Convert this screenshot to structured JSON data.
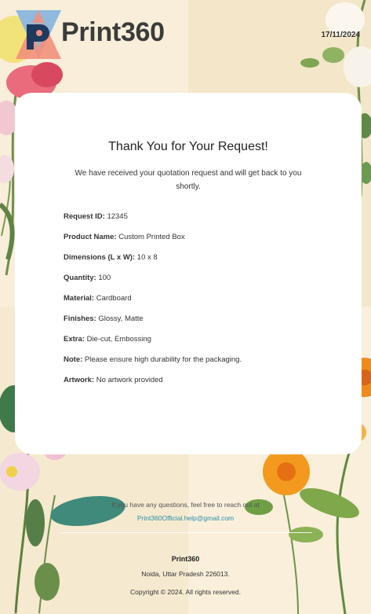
{
  "header": {
    "brand": "Print360",
    "date": "17/11/2024"
  },
  "card": {
    "title": "Thank You for Your Request!",
    "message": "We have received your quotation request and will get back to you shortly.",
    "details": [
      {
        "label": "Request ID:",
        "value": "12345"
      },
      {
        "label": "Product Name:",
        "value": "Custom Printed Box"
      },
      {
        "label": "Dimensions (L x W):",
        "value": "10 x 8"
      },
      {
        "label": "Quantity:",
        "value": "100"
      },
      {
        "label": "Material:",
        "value": "Cardboard"
      },
      {
        "label": "Finishes:",
        "value": "Glossy, Matte"
      },
      {
        "label": "Extra:",
        "value": "Die-cut, Embossing"
      },
      {
        "label": "Note:",
        "value": "Please ensure high durability for the packaging."
      },
      {
        "label": "Artwork:",
        "value": "No artwork provided"
      }
    ]
  },
  "footer": {
    "contact_text": "If you have any questions, feel free to reach out at",
    "email": "Print360Official.help@gmail.com",
    "company": "Print360",
    "address": "Noida, Uttar Pradesh 226013.",
    "copyright": "Copyright © 2024. All rights reserved."
  },
  "colors": {
    "background": "#f7edd6",
    "card": "#ffffff",
    "link": "#2a8fa8",
    "logo_blue": "#1e3a5f",
    "logo_salmon": "#f2907a",
    "logo_sky": "#8fb9dd"
  }
}
